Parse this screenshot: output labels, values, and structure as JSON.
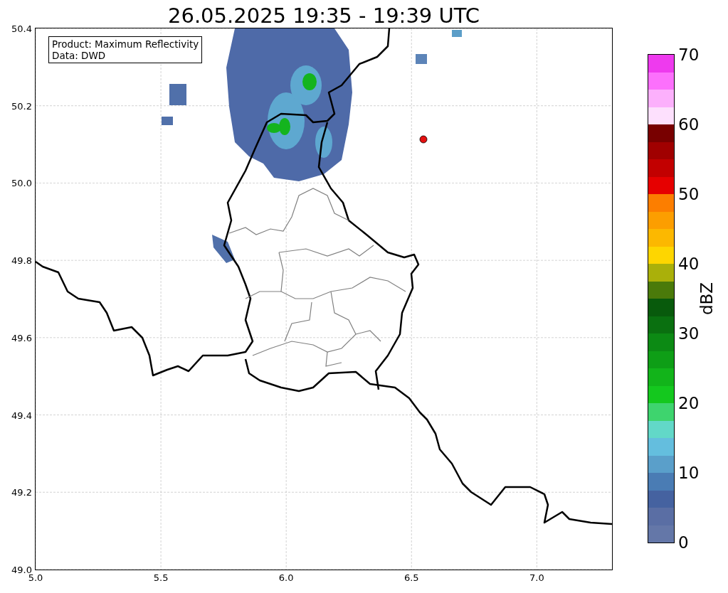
{
  "title": "26.05.2025 19:35 - 19:39 UTC",
  "info_box": [
    "Product: Maximum Reflectivity",
    "Data: DWD"
  ],
  "x_axis": {
    "ticks": [
      "5.0",
      "5.5",
      "6.0",
      "6.5",
      "7.0"
    ]
  },
  "y_axis": {
    "ticks": [
      "50.4",
      "50.2",
      "50.0",
      "49.8",
      "49.6",
      "49.4",
      "49.2",
      "49.0"
    ]
  },
  "colorbar": {
    "label": "dBZ",
    "ticks": [
      "70",
      "60",
      "50",
      "40",
      "30",
      "20",
      "10",
      "0"
    ],
    "bands": [
      {
        "color": "#6477a8"
      },
      {
        "color": "#5a6ea4"
      },
      {
        "color": "#4562a0"
      },
      {
        "color": "#4a7cb4"
      },
      {
        "color": "#5a9fca"
      },
      {
        "color": "#64bede"
      },
      {
        "color": "#62d8c8"
      },
      {
        "color": "#3ed46e"
      },
      {
        "color": "#14c81e"
      },
      {
        "color": "#12b41a"
      },
      {
        "color": "#0e9e16"
      },
      {
        "color": "#0c8a14"
      },
      {
        "color": "#0a7010"
      },
      {
        "color": "#085a0c"
      },
      {
        "color": "#4a7a0a"
      },
      {
        "color": "#aab00a"
      },
      {
        "color": "#fed600"
      },
      {
        "color": "#fcb800"
      },
      {
        "color": "#fc9e00"
      },
      {
        "color": "#fc7e00"
      },
      {
        "color": "#e60000"
      },
      {
        "color": "#c20000"
      },
      {
        "color": "#a00000"
      },
      {
        "color": "#780000"
      },
      {
        "color": "#fde0fd"
      },
      {
        "color": "#fcb0fc"
      },
      {
        "color": "#fc70fc"
      },
      {
        "color": "#ee3aee"
      }
    ]
  }
}
